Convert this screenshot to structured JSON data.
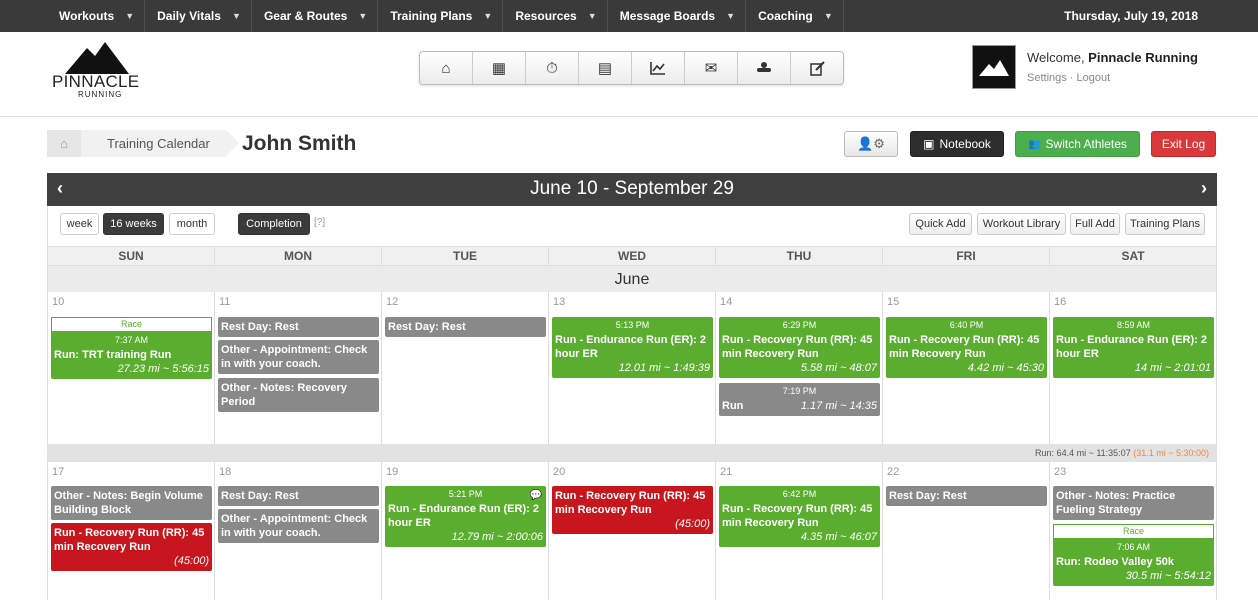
{
  "nav": {
    "items": [
      "Workouts",
      "Daily Vitals",
      "Gear & Routes",
      "Training Plans",
      "Resources",
      "Message Boards",
      "Coaching"
    ],
    "date": "Thursday, July 19, 2018"
  },
  "logo": {
    "brand": "PINNACLE",
    "sub": "RUNNING"
  },
  "user": {
    "welcome_prefix": "Welcome, ",
    "name": "Pinnacle Running",
    "settings": "Settings",
    "separator": " · ",
    "logout": "Logout"
  },
  "breadcrumb": {
    "current": "Training Calendar"
  },
  "athlete": "John Smith",
  "buttons": {
    "notebook": "Notebook",
    "switch": "Switch Athletes",
    "exit": "Exit Log"
  },
  "calendar": {
    "range": "June 10 - September 29",
    "views": {
      "week": "week",
      "weeks16": "16 weeks",
      "month": "month"
    },
    "completion": "Completion",
    "help": "[?]",
    "actions": {
      "quick_add": "Quick Add",
      "library": "Workout Library",
      "full_add": "Full Add",
      "plans": "Training Plans"
    },
    "days": [
      "SUN",
      "MON",
      "TUE",
      "WED",
      "THU",
      "FRI",
      "SAT"
    ],
    "month": "June",
    "week1_summary": {
      "main": "Run: 64.4 mi ~ 11:35:07 ",
      "extra": "(31.1 mi ~ 5:30:00)"
    },
    "week1": {
      "dates": [
        "10",
        "11",
        "12",
        "13",
        "14",
        "15",
        "16"
      ],
      "sun": {
        "race": "Race",
        "time": "7:37 AM",
        "title": "Run: TRT training Run",
        "dist": "27.23 mi ~ 5:56:15"
      },
      "mon": [
        {
          "title": "Rest Day: Rest"
        },
        {
          "title": "Other - Appointment: Check in with your coach."
        },
        {
          "title": "Other - Notes: Recovery Period"
        }
      ],
      "tue": {
        "title": "Rest Day: Rest"
      },
      "wed": {
        "time": "5:13 PM",
        "title": "Run - Endurance Run (ER): 2 hour ER",
        "dist": "12.01 mi ~ 1:49:39"
      },
      "thu": [
        {
          "time": "6:29 PM",
          "title": "Run - Recovery Run (RR): 45 min Recovery Run",
          "dist": "5.58 mi ~ 48:07"
        },
        {
          "time": "7:19 PM",
          "title": "Run",
          "dist": "1.17 mi ~ 14:35"
        }
      ],
      "fri": {
        "time": "6:40 PM",
        "title": "Run - Recovery Run (RR): 45 min Recovery Run",
        "dist": "4.42 mi ~ 45:30"
      },
      "sat": {
        "time": "8:59 AM",
        "title": "Run - Endurance Run (ER): 2 hour ER",
        "dist": "14 mi ~ 2:01:01"
      }
    },
    "week2": {
      "dates": [
        "17",
        "18",
        "19",
        "20",
        "21",
        "22",
        "23"
      ],
      "sun": [
        {
          "title": "Other - Notes: Begin Volume Building Block"
        },
        {
          "title": "Run - Recovery Run (RR): 45 min Recovery Run",
          "dist": "(45:00)"
        }
      ],
      "mon": [
        {
          "title": "Rest Day: Rest"
        },
        {
          "title": "Other - Appointment: Check in with your coach."
        }
      ],
      "tue": {
        "time": "5:21 PM",
        "title": "Run - Endurance Run (ER): 2 hour ER",
        "dist": "12.79 mi ~ 2:00:06"
      },
      "wed": {
        "title": "Run - Recovery Run (RR): 45 min Recovery Run",
        "dist": "(45:00)"
      },
      "thu": {
        "time": "6:42 PM",
        "title": "Run - Recovery Run (RR): 45 min Recovery Run",
        "dist": "4.35 mi ~ 46:07"
      },
      "fri": {
        "title": "Rest Day: Rest"
      },
      "sat": [
        {
          "title": "Other - Notes: Practice Fueling Strategy"
        },
        {
          "race": "Race",
          "time": "7:06 AM",
          "title": "Run: Rodeo Valley 50k",
          "dist": "30.5 mi ~ 5:54:12"
        }
      ]
    }
  }
}
